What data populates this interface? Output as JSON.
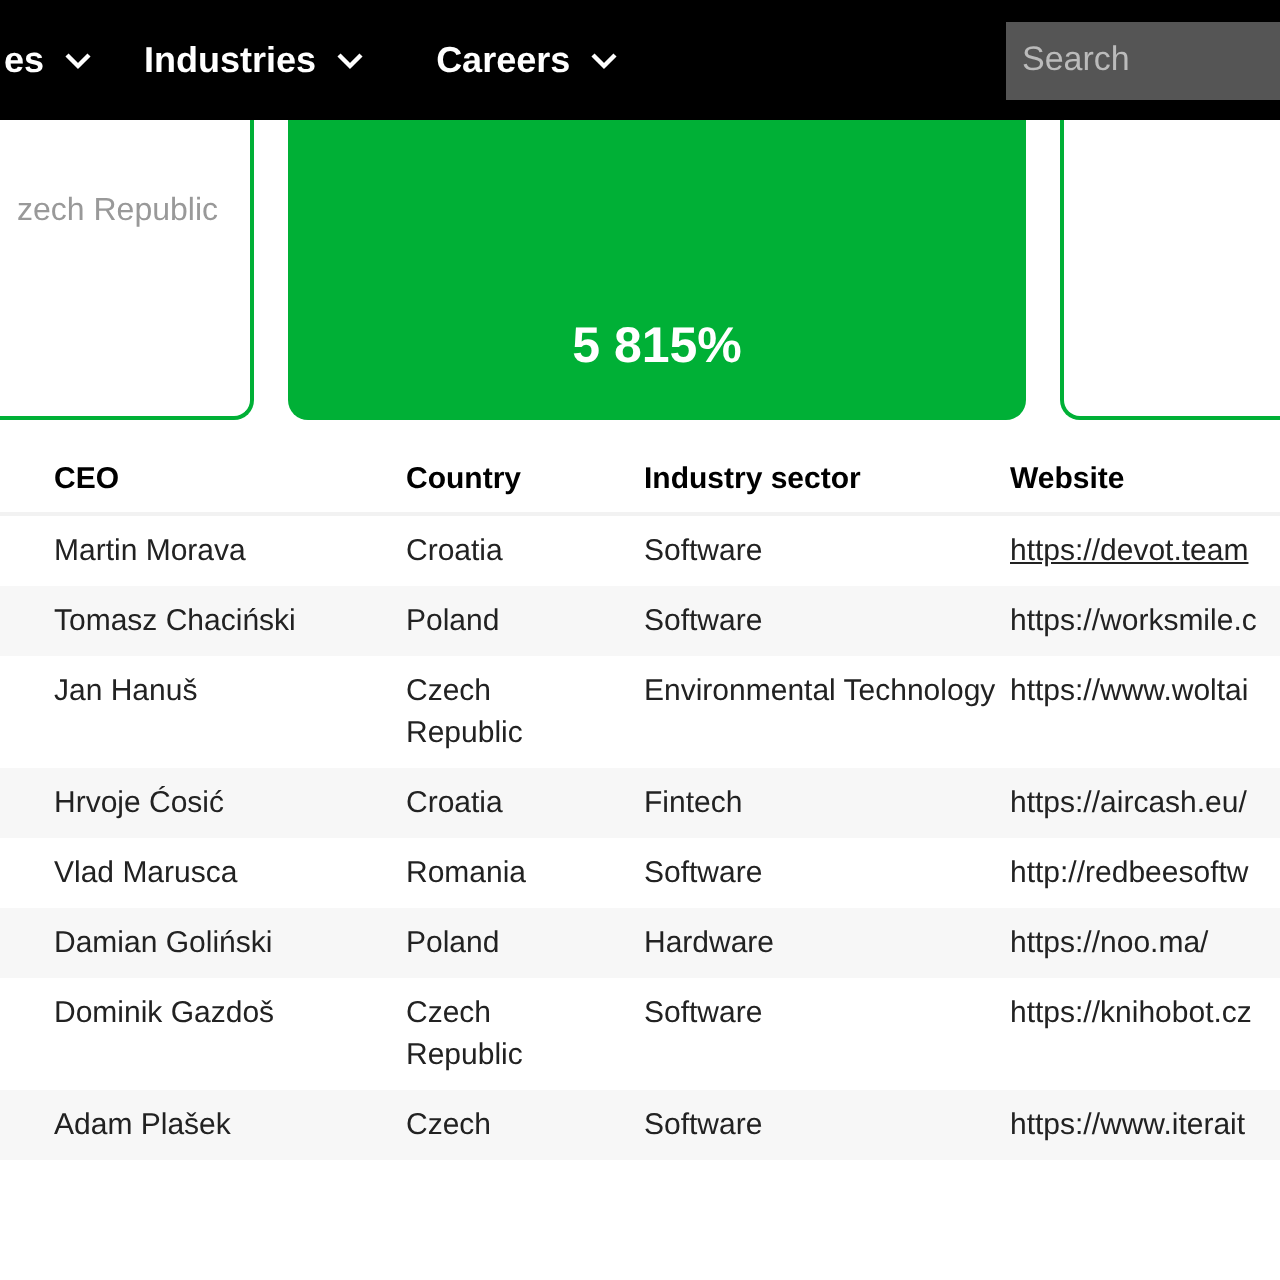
{
  "nav": {
    "items": [
      {
        "label": "es"
      },
      {
        "label": "Industries"
      },
      {
        "label": "Careers"
      }
    ],
    "search": {
      "placeholder": "Search"
    }
  },
  "cards": [
    {
      "kind": "outline",
      "text": "zech Republic"
    },
    {
      "kind": "filled",
      "text": "5 815%"
    },
    {
      "kind": "outline"
    }
  ],
  "table": {
    "columns": [
      "CEO",
      "Country",
      "Industry sector",
      "Website"
    ],
    "rows": [
      {
        "cells": [
          "Martin Morava",
          "Croatia",
          "Software",
          "https://devot.team"
        ],
        "underlined": true
      },
      {
        "cells": [
          "Tomasz Chaciński",
          "Poland",
          "Software",
          "https://worksmile.c"
        ],
        "underlined": false
      },
      {
        "cells": [
          "Jan Hanuš",
          "Czech Republic",
          "Environmental Technology",
          "https://www.woltai"
        ],
        "underlined": false
      },
      {
        "cells": [
          "Hrvoje Ćosić",
          "Croatia",
          "Fintech",
          "https://aircash.eu/"
        ],
        "underlined": false
      },
      {
        "cells": [
          "Vlad Marusca",
          "Romania",
          "Software",
          "http://redbeesoftw"
        ],
        "underlined": false
      },
      {
        "cells": [
          "Damian Goliński",
          "Poland",
          "Hardware",
          "https://noo.ma/"
        ],
        "underlined": false
      },
      {
        "cells": [
          "Dominik Gazdoš",
          "Czech Republic",
          "Software",
          "https://knihobot.cz"
        ],
        "underlined": false
      },
      {
        "cells": [
          "Adam Plašek",
          "Czech",
          "Software",
          "https://www.iterait"
        ],
        "underlined": false
      }
    ]
  }
}
